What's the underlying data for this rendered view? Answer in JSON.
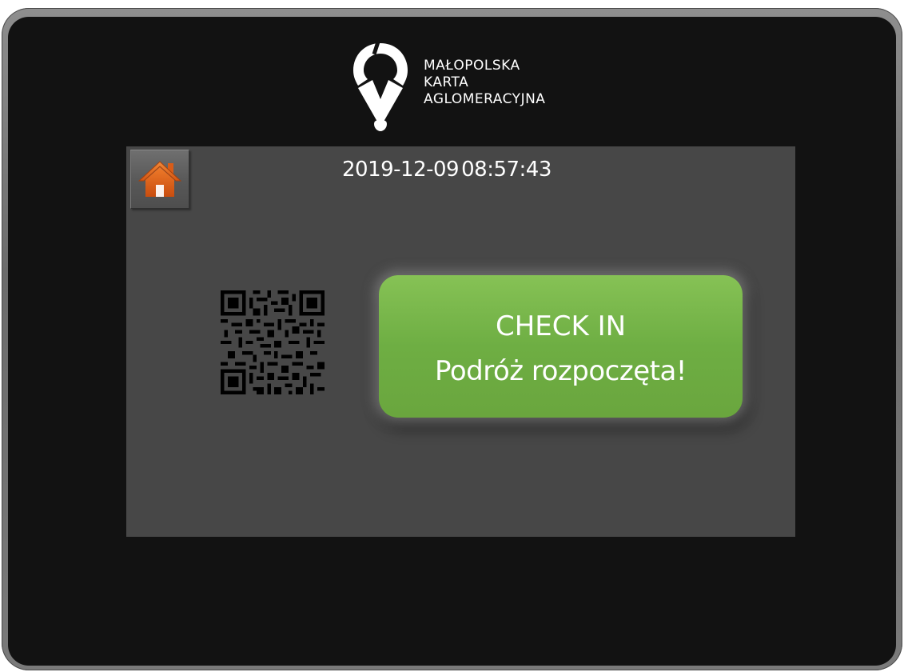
{
  "brand": {
    "name_lines": [
      "MAŁOPOLSKA",
      "KARTA",
      "AGLOMERACYJNA"
    ]
  },
  "status": {
    "date": "2019-12-09",
    "time": "08:57:43"
  },
  "check_in": {
    "title": "CHECK IN",
    "message": "Podróż rozpoczęta!"
  },
  "icons": {
    "home": "home-icon",
    "qr": "qr-code",
    "logo": "location-pin-logo"
  },
  "colors": {
    "button_green": "#6eae43",
    "home_orange": "#e0661c",
    "panel": "#474747",
    "bezel": "#121212"
  }
}
